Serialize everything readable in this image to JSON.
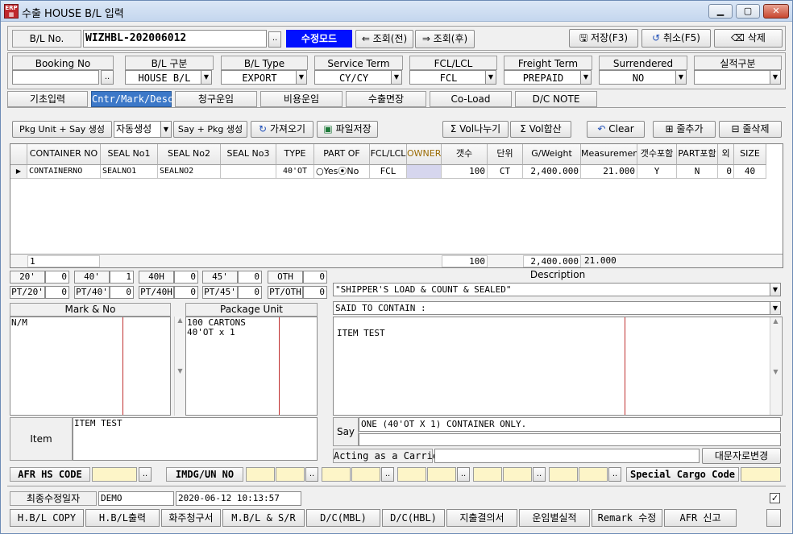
{
  "window": {
    "title": "수출 HOUSE B/L 입력",
    "app_icon": "calendar-app-icon",
    "min": "▭",
    "max": "▢",
    "close": "✕"
  },
  "header": {
    "bl_no_label": "B/L No.",
    "bl_no_value": "WIZHBL-202006012",
    "dots": "..",
    "mode_label": "수정모드",
    "prev_label": "⇐ 조회(전)",
    "next_label": "⇒ 조회(후)",
    "save_label": "저장(F3)",
    "cancel_label": "취소(F5)",
    "delete_label": "삭제"
  },
  "fields": {
    "booking_no": {
      "label": "Booking No",
      "value": ""
    },
    "bl_type_kr": {
      "label": "B/L 구분",
      "value": "HOUSE B/L"
    },
    "bl_type": {
      "label": "B/L Type",
      "value": "EXPORT"
    },
    "service_term": {
      "label": "Service Term",
      "value": "CY/CY"
    },
    "fcl_lcl": {
      "label": "FCL/LCL",
      "value": "FCL"
    },
    "freight_term": {
      "label": "Freight Term",
      "value": "PREPAID"
    },
    "surrendered": {
      "label": "Surrendered",
      "value": "NO"
    },
    "performance": {
      "label": "실적구분",
      "value": ""
    }
  },
  "tabs": [
    "기초입력",
    "Cntr/Mark/Desc",
    "청구운임",
    "비용운임",
    "수출면장",
    "Co-Load",
    "D/C NOTE"
  ],
  "toolbar": {
    "pkg_unit_say": "Pkg Unit + Say 생성",
    "auto_gen": "자동생성",
    "say_pkg": "Say + Pkg 생성",
    "fetch": "가져오기",
    "file_save": "파일저장",
    "vol_split": "Σ Vol나누기",
    "vol_sum": "Σ Vol합산",
    "clear": "Clear",
    "add_row": "줄추가",
    "del_row": "줄삭제"
  },
  "grid": {
    "headers": [
      "CONTAINER NO",
      "SEAL No1",
      "SEAL No2",
      "SEAL No3",
      "TYPE",
      "PART OF",
      "FCL/LCL",
      "OWNER",
      "갯수",
      "단위",
      "G/Weight",
      "Measurement",
      "갯수포함",
      "PART포함",
      "외",
      "SIZE"
    ],
    "rows": [
      {
        "container_no": "CONTAINERNO",
        "seal1": "SEALNO1",
        "seal2": "SEALNO2",
        "seal3": "",
        "type": "40'OT",
        "part_yes": "Yes",
        "part_no": "No",
        "fcl_lcl": "FCL",
        "owner": "",
        "qty": "100",
        "unit": "CT",
        "weight": "2,400.000",
        "measurement": "21.000",
        "qty_incl": "Y",
        "part_incl": "N",
        "other": "0",
        "size": "40"
      }
    ],
    "footer": {
      "count": "1",
      "qty": "100",
      "weight": "2,400.000",
      "measurement": "21.000"
    }
  },
  "counts": [
    {
      "label": "20'",
      "value": "0"
    },
    {
      "label": "40'",
      "value": "1"
    },
    {
      "label": "40H",
      "value": "0"
    },
    {
      "label": "45'",
      "value": "0"
    },
    {
      "label": "OTH",
      "value": "0"
    },
    {
      "label": "PT/20'",
      "value": "0"
    },
    {
      "label": "PT/40'",
      "value": "0"
    },
    {
      "label": "PT/40H",
      "value": "0"
    },
    {
      "label": "PT/45'",
      "value": "0"
    },
    {
      "label": "PT/OTH",
      "value": "0"
    }
  ],
  "mark": {
    "label": "Mark & No",
    "text": "N/M"
  },
  "package": {
    "label": "Package Unit",
    "line1": "100 CARTONS",
    "line2": "40'OT x 1"
  },
  "description": {
    "label": "Description",
    "line1": "\"SHIPPER'S LOAD & COUNT & SEALED\"",
    "line2": "SAID TO CONTAIN :",
    "body": "ITEM TEST"
  },
  "item": {
    "label": "Item",
    "text": "ITEM TEST"
  },
  "say": {
    "label": "Say",
    "line1": "ONE (40'OT X 1) CONTAINER ONLY.",
    "line2": ""
  },
  "acting": {
    "label": "Acting as a Carrier",
    "value": "",
    "button": "대문자로변경"
  },
  "codes": {
    "afr_hs": "AFR HS CODE",
    "imdg": "IMDG/UN NO",
    "special": "Special Cargo Code"
  },
  "last_modified": {
    "label": "최종수정일자",
    "user": "DEMO",
    "datetime": "2020-06-12 10:13:57"
  },
  "bottom_buttons": [
    "H.B/L COPY",
    "H.B/L출력",
    "화주청구서",
    "M.B/L & S/R",
    "D/C(MBL)",
    "D/C(HBL)",
    "지출결의서",
    "운임별실적",
    "Remark 수정",
    "AFR 신고"
  ]
}
